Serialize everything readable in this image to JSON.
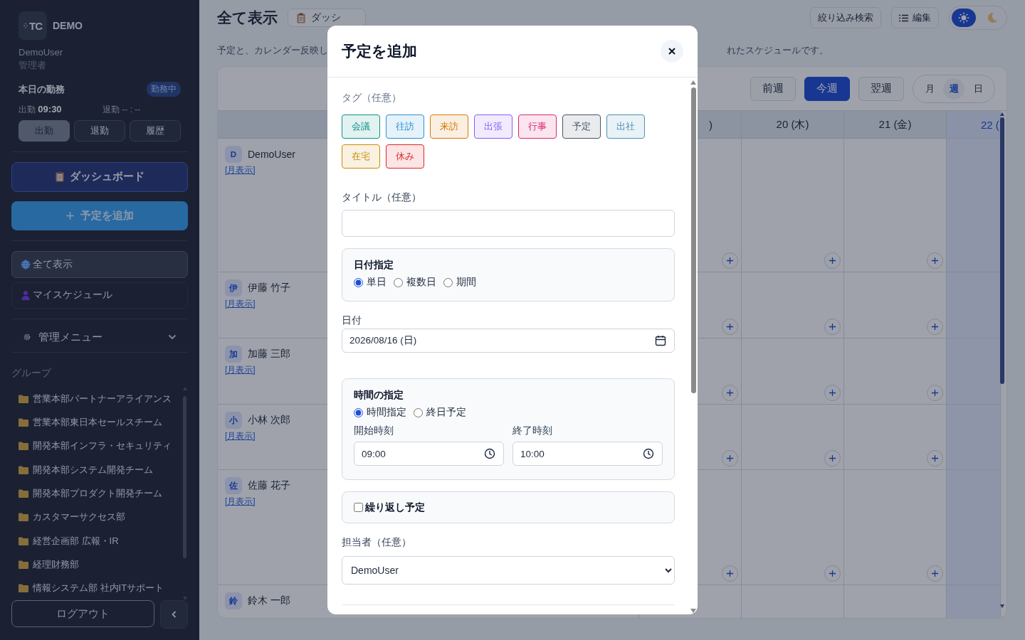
{
  "sidebar": {
    "logo_mark": "TC",
    "logo_text": "DEMO",
    "user_name": "DemoUser",
    "role": "管理者",
    "attendance": {
      "title": "本日の勤務",
      "status": "勤務中",
      "clock_in_label": "出勤",
      "clock_in_time": "09:30",
      "clock_out_label": "退勤",
      "clock_out_time": "-- : --",
      "buttons": [
        {
          "label": "出勤",
          "disabled": true
        },
        {
          "label": "退勤",
          "disabled": false
        },
        {
          "label": "履歴",
          "disabled": false
        }
      ]
    },
    "dashboard_button": "ダッシュボード",
    "add_button": "予定を追加",
    "nav": [
      {
        "label": "全て表示",
        "kind": "globe",
        "selected": true
      },
      {
        "label": "マイスケジュール",
        "kind": "person",
        "selected": false
      }
    ],
    "admin_menu": {
      "label": "管理メニュー",
      "expanded": false
    },
    "groups_title": "グループ",
    "groups": [
      "営業本部パートナーアライアンス",
      "営業本部東日本セールスチーム",
      "開発本部インフラ・セキュリティ",
      "開発本部システム開発チーム",
      "開発本部プロダクト開発チーム",
      "カスタマーサクセス部",
      "経営企画部 広報・IR",
      "経理財務部",
      "情報システム部 社内ITサポート"
    ],
    "logout": "ログアウト"
  },
  "header": {
    "title": "全て表示",
    "dashboard_button": "ダッシ",
    "subtitle_start": "予定と、カレンダー反映し",
    "subtitle_end": "れたスケジュールです。",
    "buttons": [
      {
        "label": "絞り込み検索",
        "kind": "plain"
      },
      {
        "label": "編集",
        "kind": "list"
      }
    ],
    "theme": [
      {
        "kind": "light",
        "selected": true
      },
      {
        "kind": "dark",
        "selected": false
      }
    ]
  },
  "calendar": {
    "week_nav": [
      {
        "label": "前週",
        "selected": false
      },
      {
        "label": "今週",
        "selected": true
      },
      {
        "label": "翌週",
        "selected": false
      }
    ],
    "views": [
      {
        "label": "月",
        "selected": false
      },
      {
        "label": "週",
        "selected": true
      },
      {
        "label": "日",
        "selected": false
      }
    ],
    "columns": [
      {
        "label": ")",
        "today": false
      },
      {
        "label": "20 (木)",
        "today": false
      },
      {
        "label": "21 (金)",
        "today": false
      },
      {
        "label": "22 (",
        "today": true
      }
    ],
    "rows": [
      {
        "initial": "D",
        "name": "DemoUser",
        "link": "[月表示]",
        "add_buttons": true
      },
      {
        "initial": "伊",
        "name": "伊藤 竹子",
        "link": "[月表示]",
        "add_buttons": true
      },
      {
        "initial": "加",
        "name": "加藤 三郎",
        "link": "[月表示]",
        "add_buttons": true
      },
      {
        "initial": "小",
        "name": "小林 次郎",
        "link": "[月表示]",
        "add_buttons": true
      },
      {
        "initial": "佐",
        "name": "佐藤 花子",
        "link": "[月表示]",
        "add_buttons": true
      },
      {
        "initial": "鈴",
        "name": "鈴木 一郎",
        "add_buttons": false
      }
    ]
  },
  "modal": {
    "title": "予定を追加",
    "tags_label": "タグ（任意）",
    "tags": [
      {
        "label": "会議",
        "color": "#0d9488"
      },
      {
        "label": "往訪",
        "color": "#2b8fd6"
      },
      {
        "label": "来訪",
        "color": "#d97706"
      },
      {
        "label": "出張",
        "color": "#8b5cf6"
      },
      {
        "label": "行事",
        "color": "#db2777"
      },
      {
        "label": "予定",
        "color": "#475569"
      },
      {
        "label": "出社",
        "color": "#4a90b8"
      },
      {
        "label": "在宅",
        "color": "#ca8a04"
      },
      {
        "label": "休み",
        "color": "#dc2626"
      }
    ],
    "title_label": "タイトル（任意）",
    "date_mode": {
      "label": "日付指定",
      "options": [
        {
          "label": "単日",
          "selected": true
        },
        {
          "label": "複数日",
          "selected": false
        },
        {
          "label": "期間",
          "selected": false
        }
      ]
    },
    "date_label": "日付",
    "date_value": "2026/08/16 (日)",
    "time_mode": {
      "label": "時間の指定",
      "options": [
        {
          "label": "時間指定",
          "selected": true
        },
        {
          "label": "終日予定",
          "selected": false
        }
      ],
      "start_label": "開始時刻",
      "start_value": "09:00",
      "end_label": "終了時刻",
      "end_value": "10:00"
    },
    "repeat": {
      "label": "繰り返し予定",
      "checked": false
    },
    "assignee_label": "担当者（任意）",
    "assignee_value": "DemoUser"
  }
}
